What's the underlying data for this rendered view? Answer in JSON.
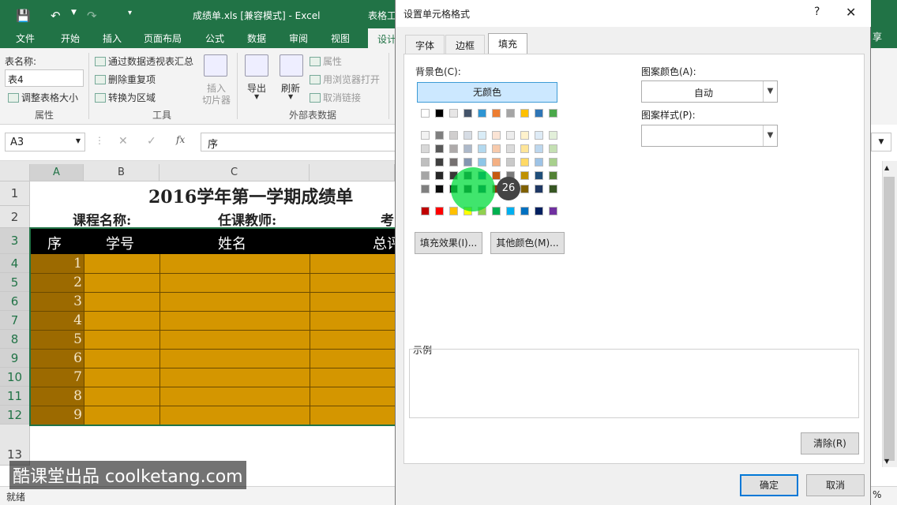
{
  "excel": {
    "title": "成绩单.xls  [兼容模式] - Excel",
    "title_right": "表格工",
    "tabs": [
      "文件",
      "开始",
      "插入",
      "页面布局",
      "公式",
      "数据",
      "审阅",
      "视图",
      "设计"
    ],
    "ribbon": {
      "table_name_label": "表名称:",
      "table_name_value": "表4",
      "resize_table": "调整表格大小",
      "group_properties": "属性",
      "pivot": "通过数据透视表汇总",
      "remove_dup": "删除重复项",
      "convert_range": "转换为区域",
      "group_tools": "工具",
      "insert_slicer_1": "插入",
      "insert_slicer_2": "切片器",
      "export": "导出",
      "refresh": "刷新",
      "properties": "属性",
      "open_browser": "用浏览器打开",
      "unlink": "取消链接",
      "group_external": "外部表数据"
    },
    "name_box": "A3",
    "formula": "序",
    "columns": [
      "A",
      "B",
      "C"
    ],
    "rows": [
      "1",
      "2",
      "3",
      "4",
      "5",
      "6",
      "7",
      "8",
      "9",
      "10",
      "11",
      "12",
      "13"
    ],
    "sheet_title": "2016学年第一学期成绩单",
    "course_label": "课程名称:",
    "teacher_label": "任课教师:",
    "exam_label": "考",
    "headers": [
      "序",
      "学号",
      "姓名",
      "总评"
    ],
    "serials": [
      "1",
      "2",
      "3",
      "4",
      "5",
      "6",
      "7",
      "8",
      "9"
    ],
    "status": "就绪"
  },
  "dialog": {
    "title": "设置单元格格式",
    "help": "?",
    "close": "✕",
    "tabs": [
      "字体",
      "边框",
      "填充"
    ],
    "bg_color_label": "背景色(C):",
    "no_color": "无颜色",
    "theme_row": [
      "#ffffff",
      "#000000",
      "#e7e6e6",
      "#44546a",
      "#2e95d3",
      "#ed7d31",
      "#a5a5a5",
      "#ffc000",
      "#2e75b6",
      "#4aa84a"
    ],
    "shade_rows": [
      [
        "#f2f2f2",
        "#7f7f7f",
        "#d0cece",
        "#d6dce4",
        "#d9ecf7",
        "#fbe4d5",
        "#ededed",
        "#fff2cc",
        "#deebf6",
        "#e2efd9"
      ],
      [
        "#d8d8d8",
        "#595959",
        "#aeaaaa",
        "#adb9ca",
        "#b3d9ef",
        "#f7caac",
        "#dbdbdb",
        "#fee599",
        "#bdd7ee",
        "#c5e0b3"
      ],
      [
        "#bfbfbf",
        "#3f3f3f",
        "#757070",
        "#8496b0",
        "#8ec6e7",
        "#f4b083",
        "#c9c9c9",
        "#ffd965",
        "#9dc3e6",
        "#a8d08d"
      ],
      [
        "#a5a5a5",
        "#262626",
        "#3a3838",
        "#323f4f",
        "#1b6a9a",
        "#c55a11",
        "#7b7b7b",
        "#bf9000",
        "#1f4e79",
        "#538135"
      ],
      [
        "#7f7f7f",
        "#0c0c0c",
        "#171616",
        "#222a35",
        "#124766",
        "#833c0b",
        "#525252",
        "#7f6000",
        "#1f3864",
        "#375623"
      ]
    ],
    "standard_row": [
      "#c00000",
      "#ff0000",
      "#ffc000",
      "#ffff00",
      "#92d050",
      "#00b050",
      "#00b0f0",
      "#0070c0",
      "#002060",
      "#7030a0"
    ],
    "fill_effects": "填充效果(I)...",
    "more_colors": "其他颜色(M)...",
    "pattern_color_label": "图案颜色(A):",
    "pattern_color_value": "自动",
    "pattern_style_label": "图案样式(P):",
    "sample_label": "示例",
    "clear": "清除(R)",
    "ok": "确定",
    "cancel": "取消"
  },
  "cursor_badge": "26",
  "watermark": "酷课堂出品 coolketang.com",
  "right_edge": {
    "ribbon_char": "享",
    "zoom_char": "%"
  }
}
